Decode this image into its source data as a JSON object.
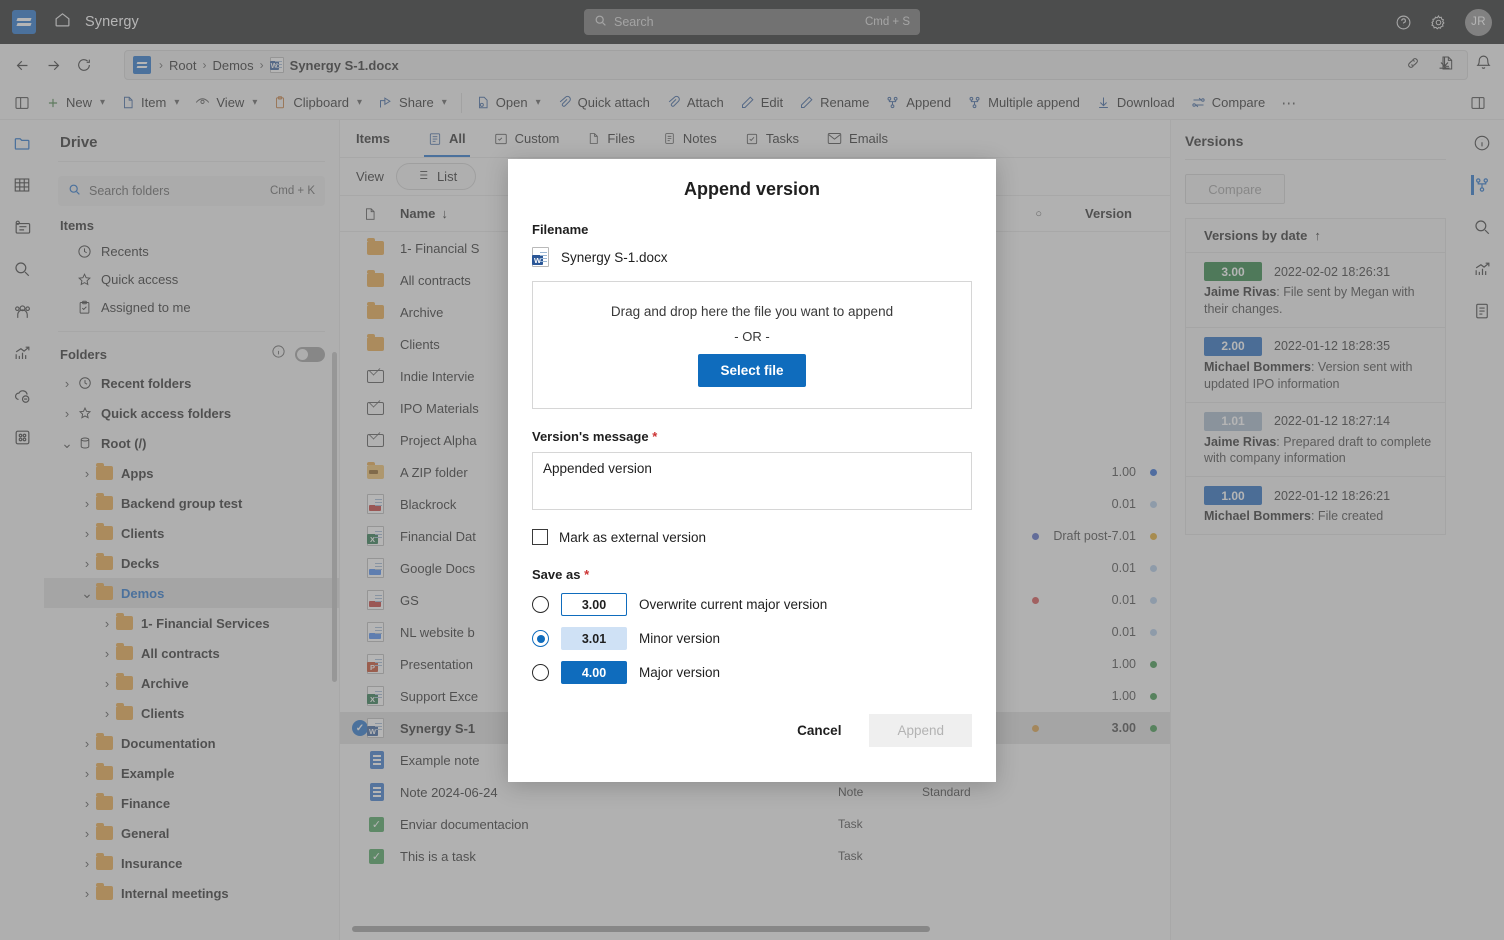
{
  "topbar": {
    "brand": "Synergy",
    "home_icon": "home-icon",
    "search": {
      "placeholder": "Search",
      "shortcut": "Cmd + S",
      "icon": "search-icon"
    },
    "help_icon": "help-icon",
    "settings_icon": "gear-icon",
    "avatar_initials": "JR"
  },
  "breadcrumb": {
    "back_icon": "back-arrow-icon",
    "forward_icon": "forward-arrow-icon",
    "refresh_icon": "refresh-icon",
    "items": [
      "Root",
      "Demos",
      "Synergy S-1.docx"
    ],
    "end_icons": [
      "link-icon",
      "copy-page-icon",
      "download-icon",
      "bell-icon"
    ]
  },
  "ribbon": {
    "panel_toggle_icon": "panel-left-icon",
    "buttons": [
      {
        "label": "New",
        "icon": "plus-icon",
        "caret": true
      },
      {
        "label": "Item",
        "icon": "item-icon",
        "caret": true
      },
      {
        "label": "View",
        "icon": "view-icon",
        "caret": true
      },
      {
        "label": "Clipboard",
        "icon": "clipboard-icon",
        "caret": true
      },
      {
        "label": "Share",
        "icon": "share-icon",
        "caret": true
      },
      {
        "label": "Open",
        "icon": "open-icon",
        "caret": true
      },
      {
        "label": "Quick attach",
        "icon": "paperclip-icon",
        "caret": false
      },
      {
        "label": "Attach",
        "icon": "paperclip-icon",
        "caret": false
      },
      {
        "label": "Edit",
        "icon": "pencil-icon",
        "caret": false
      },
      {
        "label": "Rename",
        "icon": "pencil-icon",
        "caret": false
      },
      {
        "label": "Append",
        "icon": "branch-icon",
        "caret": false
      },
      {
        "label": "Multiple append",
        "icon": "branch-icon",
        "caret": false
      },
      {
        "label": "Download",
        "icon": "download-icon",
        "caret": false
      },
      {
        "label": "Compare",
        "icon": "compare-icon",
        "caret": false
      },
      {
        "label": "⋯",
        "icon": "more-icon",
        "caret": false
      }
    ],
    "right_panel_toggle_icon": "panel-right-icon"
  },
  "left_rail": {
    "icons": [
      "folder-icon",
      "grid-icon",
      "card-icon",
      "search-icon",
      "team-icon",
      "analytics-icon",
      "cloud-icon",
      "apps-icon"
    ],
    "active_index": 0
  },
  "sidebar": {
    "title": "Drive",
    "search": {
      "placeholder": "Search folders",
      "shortcut": "Cmd + K",
      "icon": "search-icon"
    },
    "items_group_label": "Items",
    "items": [
      {
        "label": "Recents",
        "icon": "clock-icon"
      },
      {
        "label": "Quick access",
        "icon": "star-icon"
      },
      {
        "label": "Assigned to me",
        "icon": "clipboard-check-icon"
      }
    ],
    "folders_group_label": "Folders",
    "folders_info_icon": "info-icon",
    "folders_toggle": "off",
    "tree": [
      {
        "label": "Recent folders",
        "icon": "clock-icon",
        "indent": 0,
        "expanded": false,
        "selected": false,
        "twisty": "›"
      },
      {
        "label": "Quick access folders",
        "icon": "star-icon",
        "indent": 0,
        "expanded": false,
        "selected": false,
        "twisty": "›"
      },
      {
        "label": "Root (/)",
        "icon": "database-icon",
        "indent": 0,
        "expanded": true,
        "selected": false,
        "twisty": "⌄"
      },
      {
        "label": "Apps",
        "icon": "folder-icon",
        "indent": 1,
        "expanded": false,
        "selected": false,
        "twisty": "›"
      },
      {
        "label": "Backend group test",
        "icon": "folder-icon",
        "indent": 1,
        "expanded": false,
        "selected": false,
        "twisty": "›"
      },
      {
        "label": "Clients",
        "icon": "folder-icon",
        "indent": 1,
        "expanded": false,
        "selected": false,
        "twisty": "›"
      },
      {
        "label": "Decks",
        "icon": "folder-icon",
        "indent": 1,
        "expanded": false,
        "selected": false,
        "twisty": "›"
      },
      {
        "label": "Demos",
        "icon": "folder-icon",
        "indent": 1,
        "expanded": true,
        "selected": true,
        "twisty": "⌄"
      },
      {
        "label": "1- Financial Services",
        "icon": "folder-icon",
        "indent": 2,
        "expanded": false,
        "selected": false,
        "twisty": "›"
      },
      {
        "label": "All contracts",
        "icon": "folder-icon",
        "indent": 2,
        "expanded": false,
        "selected": false,
        "twisty": "›"
      },
      {
        "label": "Archive",
        "icon": "folder-icon",
        "indent": 2,
        "expanded": false,
        "selected": false,
        "twisty": "›"
      },
      {
        "label": "Clients",
        "icon": "folder-icon",
        "indent": 2,
        "expanded": false,
        "selected": false,
        "twisty": "›"
      },
      {
        "label": "Documentation",
        "icon": "folder-icon",
        "indent": 1,
        "expanded": false,
        "selected": false,
        "twisty": "›"
      },
      {
        "label": "Example",
        "icon": "folder-icon",
        "indent": 1,
        "expanded": false,
        "selected": false,
        "twisty": "›"
      },
      {
        "label": "Finance",
        "icon": "folder-icon",
        "indent": 1,
        "expanded": false,
        "selected": false,
        "twisty": "›"
      },
      {
        "label": "General",
        "icon": "folder-icon",
        "indent": 1,
        "expanded": false,
        "selected": false,
        "twisty": "›"
      },
      {
        "label": "Insurance",
        "icon": "folder-icon",
        "indent": 1,
        "expanded": false,
        "selected": false,
        "twisty": "›"
      },
      {
        "label": "Internal meetings",
        "icon": "folder-icon",
        "indent": 1,
        "expanded": false,
        "selected": false,
        "twisty": "›"
      }
    ]
  },
  "center": {
    "tabs": [
      {
        "label": "Items",
        "icon": "",
        "active": false,
        "first": true
      },
      {
        "label": "All",
        "icon": "list-icon",
        "active": true
      },
      {
        "label": "Custom",
        "icon": "custom-icon",
        "active": false
      },
      {
        "label": "Files",
        "icon": "file-icon",
        "active": false
      },
      {
        "label": "Notes",
        "icon": "note-icon",
        "active": false
      },
      {
        "label": "Tasks",
        "icon": "task-icon",
        "active": false
      },
      {
        "label": "Emails",
        "icon": "mail-icon",
        "active": false
      }
    ],
    "view_label": "View",
    "view_mode": "List",
    "view_mode_icon": "list-icon",
    "columns": {
      "icon": "file-icon",
      "name": "Name",
      "sort": "↓",
      "dot": "○",
      "version": "Version"
    },
    "rows": [
      {
        "name": "1- Financial S",
        "icon": "folder",
        "type": "",
        "cls": "",
        "dotl": "",
        "version": "",
        "dotr": "",
        "selected": false
      },
      {
        "name": "All contracts",
        "icon": "folder",
        "type": "",
        "cls": "",
        "dotl": "",
        "version": "",
        "dotr": "",
        "selected": false
      },
      {
        "name": "Archive",
        "icon": "folder",
        "type": "",
        "cls": "",
        "dotl": "",
        "version": "",
        "dotr": "",
        "selected": false
      },
      {
        "name": "Clients",
        "icon": "folder",
        "type": "",
        "cls": "",
        "dotl": "",
        "version": "",
        "dotr": "",
        "selected": false
      },
      {
        "name": "Indie Intervie",
        "icon": "mail",
        "type": "",
        "cls": "",
        "dotl": "",
        "version": "",
        "dotr": "",
        "selected": false
      },
      {
        "name": "IPO Materials",
        "icon": "mail",
        "type": "",
        "cls": "",
        "dotl": "",
        "version": "",
        "dotr": "",
        "selected": false
      },
      {
        "name": "Project Alpha",
        "icon": "mail",
        "type": "",
        "cls": "",
        "dotl": "",
        "version": "",
        "dotr": "",
        "selected": false
      },
      {
        "name": "A ZIP folder",
        "icon": "zip",
        "type": "",
        "cls": "",
        "dotl": "",
        "version": "1.00",
        "dotr": "#1f5fd0",
        "selected": false
      },
      {
        "name": "Blackrock",
        "icon": "pdf",
        "type": "",
        "cls": "",
        "dotl": "",
        "version": "0.01",
        "dotr": "#a9c6e5",
        "selected": false
      },
      {
        "name": "Financial Dat",
        "icon": "excel",
        "type": "",
        "cls": "",
        "dotl": "#4a5fc1",
        "version": "Draft post-7.01",
        "dotr": "#e0a41f",
        "selected": false
      },
      {
        "name": "Google Docs",
        "icon": "gdoc",
        "type": "",
        "cls": "",
        "dotl": "",
        "version": "0.01",
        "dotr": "#a9c6e5",
        "selected": false
      },
      {
        "name": "GS",
        "icon": "pdf",
        "type": "",
        "cls": "",
        "dotl": "#d24545",
        "version": "0.01",
        "dotr": "#a9c6e5",
        "selected": false
      },
      {
        "name": "NL website b",
        "icon": "gdoc",
        "type": "",
        "cls": "",
        "dotl": "",
        "version": "0.01",
        "dotr": "#a9c6e5",
        "selected": false
      },
      {
        "name": "Presentation",
        "icon": "ppt",
        "type": "",
        "cls": "",
        "dotl": "",
        "version": "1.00",
        "dotr": "#2f8f3e",
        "selected": false
      },
      {
        "name": "Support Exce",
        "icon": "excel",
        "type": "",
        "cls": "",
        "dotl": "",
        "version": "1.00",
        "dotr": "#2f8f3e",
        "selected": false
      },
      {
        "name": "Synergy S-1",
        "icon": "word",
        "type": "",
        "cls": "",
        "dotl": "#d99a3a",
        "version": "3.00",
        "dotr": "#2f8f3e",
        "selected": true
      },
      {
        "name": "Example note",
        "icon": "note",
        "type": "",
        "cls": "",
        "dotl": "",
        "version": "",
        "dotr": "",
        "selected": false
      },
      {
        "name": "Note 2024-06-24",
        "icon": "note",
        "type": "Note",
        "cls": "Standard",
        "dotl": "",
        "version": "",
        "dotr": "",
        "selected": false
      },
      {
        "name": "Enviar documentacion",
        "icon": "task",
        "type": "Task",
        "cls": "",
        "dotl": "",
        "version": "",
        "dotr": "",
        "selected": false
      },
      {
        "name": "This is a task",
        "icon": "task",
        "type": "Task",
        "cls": "",
        "dotl": "",
        "version": "",
        "dotr": "",
        "selected": false
      }
    ]
  },
  "versions_panel": {
    "title": "Versions",
    "info_icon": "info-icon",
    "compare_label": "Compare",
    "list_header": "Versions by date",
    "sort_arrow": "↑",
    "versions": [
      {
        "badge": "3.00",
        "badge_color": "#1e7a35",
        "date": "2022-02-02 18:26:31",
        "author": "Jaime Rivas",
        "message": "File sent by Megan with their changes."
      },
      {
        "badge": "2.00",
        "badge_color": "#1460ba",
        "date": "2022-01-12 18:28:35",
        "author": "Michael Bommers",
        "message": "Version sent with updated IPO information"
      },
      {
        "badge": "1.01",
        "badge_color": "#9fb3c8",
        "date": "2022-01-12 18:27:14",
        "author": "Jaime Rivas",
        "message": "Prepared draft to complete with company information"
      },
      {
        "badge": "1.00",
        "badge_color": "#1460ba",
        "date": "2022-01-12 18:26:21",
        "author": "Michael Bommers",
        "message": "File created"
      }
    ]
  },
  "right_rail": {
    "icons": [
      "info-icon",
      "branch-icon",
      "search-icon",
      "analytics-icon",
      "document-icon"
    ],
    "active_index": 1
  },
  "modal": {
    "title": "Append version",
    "filename_label": "Filename",
    "filename": "Synergy S-1.docx",
    "filename_icon": "word-icon",
    "dropzone_text": "Drag and drop here the file you want to append",
    "dropzone_or": "- OR -",
    "select_file_label": "Select file",
    "message_label": "Version's message",
    "message_required": "*",
    "message_value": "Appended version",
    "checkbox_label": "Mark as external version",
    "checkbox_checked": false,
    "saveas_label": "Save as",
    "saveas_required": "*",
    "options": [
      {
        "version": "3.00",
        "label": "Overwrite current major version",
        "style": "outline",
        "selected": false
      },
      {
        "version": "3.01",
        "label": "Minor version",
        "style": "soft",
        "selected": true
      },
      {
        "version": "4.00",
        "label": "Major version",
        "style": "solid",
        "selected": false
      }
    ],
    "cancel_label": "Cancel",
    "append_label": "Append",
    "append_disabled": true
  },
  "colors": {
    "accent": "#0f6cbd",
    "brand_blue": "#1668c8",
    "topbar_bg": "#18191a",
    "required_red": "#cc3333"
  }
}
